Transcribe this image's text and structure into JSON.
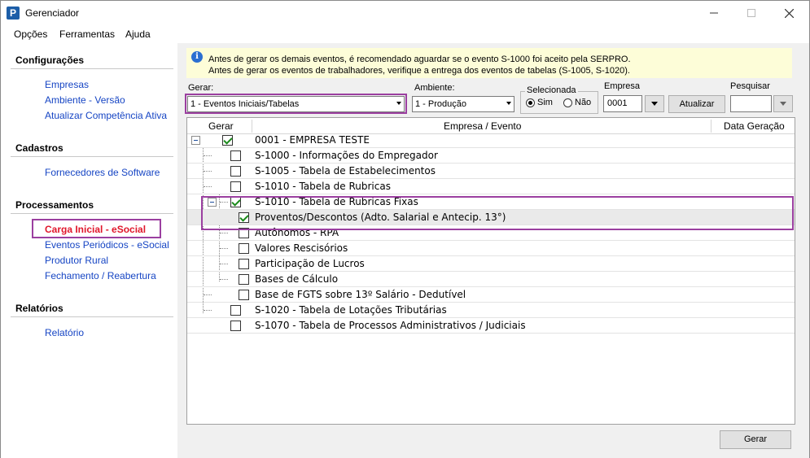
{
  "window": {
    "title": "Gerenciador",
    "app_icon": "P"
  },
  "menu": [
    "Opções",
    "Ferramentas",
    "Ajuda"
  ],
  "sidebar": {
    "sections": [
      {
        "title": "Configurações",
        "items": [
          "Empresas",
          "Ambiente - Versão",
          "Atualizar Competência Ativa"
        ]
      },
      {
        "title": "Cadastros",
        "items": [
          "Fornecedores de Software"
        ]
      },
      {
        "title": "Processamentos",
        "items": [
          "Carga Inicial - eSocial",
          "Eventos Periódicos - eSocial",
          "Produtor Rural",
          "Fechamento / Reabertura"
        ]
      },
      {
        "title": "Relatórios",
        "items": [
          "Relatório"
        ]
      }
    ],
    "active_item": "Carga Inicial - eSocial"
  },
  "info": {
    "line1": "Antes de gerar os demais eventos, é recomendado aguardar se o evento S-1000 foi aceito pela SERPRO.",
    "line2": "Antes de gerar os eventos de trabalhadores, verifique a entrega dos eventos de tabelas (S-1005, S-1020)."
  },
  "filters": {
    "gerar_label": "Gerar:",
    "gerar_value": "1 - Eventos Iniciais/Tabelas",
    "ambiente_label": "Ambiente:",
    "ambiente_value": "1 - Produção",
    "selecionada_label": "Selecionada",
    "sim_label": "Sim",
    "nao_label": "Não",
    "selecionada_value": "Sim",
    "empresa_label": "Empresa",
    "empresa_value": "0001",
    "atualizar_label": "Atualizar",
    "pesquisar_label": "Pesquisar",
    "pesquisar_value": ""
  },
  "tree": {
    "headers": {
      "gerar": "Gerar",
      "evento": "Empresa / Evento",
      "data": "Data Geração"
    },
    "rows": [
      {
        "text": "0001 - EMPRESA TESTE",
        "checked": true,
        "expander": true
      },
      {
        "text": "S-1000 - Informações do Empregador",
        "checked": false
      },
      {
        "text": "S-1005 - Tabela de Estabelecimentos",
        "checked": false
      },
      {
        "text": "S-1010 - Tabela de Rubricas",
        "checked": false
      },
      {
        "text": "S-1010 - Tabela de Rubricas Fixas",
        "checked": true,
        "expander": true
      },
      {
        "text": "Proventos/Descontos (Adto. Salarial e Antecip. 13°)",
        "checked": true,
        "selected": true
      },
      {
        "text": "Autônomos - RPA",
        "checked": false
      },
      {
        "text": "Valores Rescisórios",
        "checked": false
      },
      {
        "text": "Participação de Lucros",
        "checked": false
      },
      {
        "text": "Bases de Cálculo",
        "checked": false
      },
      {
        "text": "Base de FGTS sobre 13º Salário - Dedutível",
        "checked": false
      },
      {
        "text": "S-1020 - Tabela de Lotações Tributárias",
        "checked": false
      },
      {
        "text": "S-1070 - Tabela de Processos Administrativos / Judiciais",
        "checked": false
      }
    ]
  },
  "footer": {
    "gerar_button": "Gerar"
  },
  "colors": {
    "link": "#1645c4",
    "active_link": "#e0162b",
    "highlight": "#9b3fa0",
    "info_bg": "#fdfdd8"
  }
}
